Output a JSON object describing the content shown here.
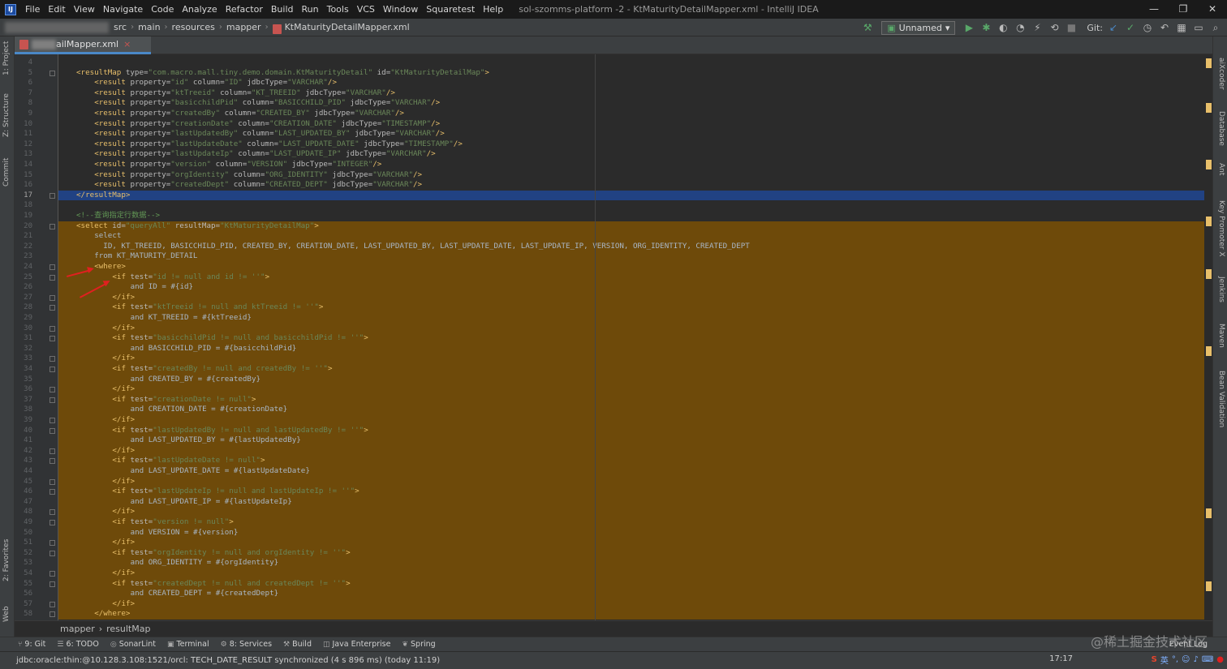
{
  "menu": {
    "items": [
      "File",
      "Edit",
      "View",
      "Navigate",
      "Code",
      "Analyze",
      "Refactor",
      "Build",
      "Run",
      "Tools",
      "VCS",
      "Window",
      "Squaretest",
      "Help"
    ],
    "window_title": "sol-szomms-platform -2 - KtMaturityDetailMapper.xml - IntelliJ IDEA"
  },
  "nav": {
    "crumbs": [
      "src",
      "main",
      "resources",
      "mapper",
      "KtMaturityDetailMapper.xml"
    ],
    "run_config": "Unnamed",
    "git_label": "Git:"
  },
  "tab": {
    "name": "ailMapper.xml",
    "close": "×"
  },
  "left_tools": [
    "1: Project",
    "Z: Structure",
    "Commit",
    "2: Favorites",
    "Web"
  ],
  "right_tools": [
    "aiXcoder",
    "Database",
    "Ant",
    "Key Promoter X",
    "Jenkins",
    "Maven",
    "Bean Validation"
  ],
  "editor": {
    "current_line": 17,
    "lines": [
      {
        "n": 4,
        "parts": []
      },
      {
        "n": 5,
        "parts": [
          [
            "tag",
            "<resultMap "
          ],
          [
            "attr",
            "type="
          ],
          [
            "val",
            "\"com.macro.mall.tiny.demo.domain.KtMaturityDetail\" "
          ],
          [
            "attr",
            "id="
          ],
          [
            "val",
            "\"KtMaturityDetailMap\""
          ],
          [
            "tag",
            ">"
          ]
        ],
        "indent": 0
      },
      {
        "n": 6,
        "parts": [
          [
            "tag",
            "<result "
          ],
          [
            "attr",
            "property="
          ],
          [
            "val",
            "\"id\" "
          ],
          [
            "attr",
            "column="
          ],
          [
            "val",
            "\"ID\" "
          ],
          [
            "attr",
            "jdbcType="
          ],
          [
            "val",
            "\"VARCHAR\""
          ],
          [
            "tag",
            "/>"
          ]
        ],
        "indent": 1
      },
      {
        "n": 7,
        "parts": [
          [
            "tag",
            "<result "
          ],
          [
            "attr",
            "property="
          ],
          [
            "val",
            "\"ktTreeid\" "
          ],
          [
            "attr",
            "column="
          ],
          [
            "val",
            "\"KT_TREEID\" "
          ],
          [
            "attr",
            "jdbcType="
          ],
          [
            "val",
            "\"VARCHAR\""
          ],
          [
            "tag",
            "/>"
          ]
        ],
        "indent": 1
      },
      {
        "n": 8,
        "parts": [
          [
            "tag",
            "<result "
          ],
          [
            "attr",
            "property="
          ],
          [
            "val",
            "\"basicchildPid\" "
          ],
          [
            "attr",
            "column="
          ],
          [
            "val",
            "\"BASICCHILD_PID\" "
          ],
          [
            "attr",
            "jdbcType="
          ],
          [
            "val",
            "\"VARCHAR\""
          ],
          [
            "tag",
            "/>"
          ]
        ],
        "indent": 1
      },
      {
        "n": 9,
        "parts": [
          [
            "tag",
            "<result "
          ],
          [
            "attr",
            "property="
          ],
          [
            "val",
            "\"createdBy\" "
          ],
          [
            "attr",
            "column="
          ],
          [
            "val",
            "\"CREATED_BY\" "
          ],
          [
            "attr",
            "jdbcType="
          ],
          [
            "val",
            "\"VARCHAR\""
          ],
          [
            "tag",
            "/>"
          ]
        ],
        "indent": 1
      },
      {
        "n": 10,
        "parts": [
          [
            "tag",
            "<result "
          ],
          [
            "attr",
            "property="
          ],
          [
            "val",
            "\"creationDate\" "
          ],
          [
            "attr",
            "column="
          ],
          [
            "val",
            "\"CREATION_DATE\" "
          ],
          [
            "attr",
            "jdbcType="
          ],
          [
            "val",
            "\"TIMESTAMP\""
          ],
          [
            "tag",
            "/>"
          ]
        ],
        "indent": 1
      },
      {
        "n": 11,
        "parts": [
          [
            "tag",
            "<result "
          ],
          [
            "attr",
            "property="
          ],
          [
            "val",
            "\"lastUpdatedBy\" "
          ],
          [
            "attr",
            "column="
          ],
          [
            "val",
            "\"LAST_UPDATED_BY\" "
          ],
          [
            "attr",
            "jdbcType="
          ],
          [
            "val",
            "\"VARCHAR\""
          ],
          [
            "tag",
            "/>"
          ]
        ],
        "indent": 1
      },
      {
        "n": 12,
        "parts": [
          [
            "tag",
            "<result "
          ],
          [
            "attr",
            "property="
          ],
          [
            "val",
            "\"lastUpdateDate\" "
          ],
          [
            "attr",
            "column="
          ],
          [
            "val",
            "\"LAST_UPDATE_DATE\" "
          ],
          [
            "attr",
            "jdbcType="
          ],
          [
            "val",
            "\"TIMESTAMP\""
          ],
          [
            "tag",
            "/>"
          ]
        ],
        "indent": 1
      },
      {
        "n": 13,
        "parts": [
          [
            "tag",
            "<result "
          ],
          [
            "attr",
            "property="
          ],
          [
            "val",
            "\"lastUpdateIp\" "
          ],
          [
            "attr",
            "column="
          ],
          [
            "val",
            "\"LAST_UPDATE_IP\" "
          ],
          [
            "attr",
            "jdbcType="
          ],
          [
            "val",
            "\"VARCHAR\""
          ],
          [
            "tag",
            "/>"
          ]
        ],
        "indent": 1
      },
      {
        "n": 14,
        "parts": [
          [
            "tag",
            "<result "
          ],
          [
            "attr",
            "property="
          ],
          [
            "val",
            "\"version\" "
          ],
          [
            "attr",
            "column="
          ],
          [
            "val",
            "\"VERSION\" "
          ],
          [
            "attr",
            "jdbcType="
          ],
          [
            "val",
            "\"INTEGER\""
          ],
          [
            "tag",
            "/>"
          ]
        ],
        "indent": 1
      },
      {
        "n": 15,
        "parts": [
          [
            "tag",
            "<result "
          ],
          [
            "attr",
            "property="
          ],
          [
            "val",
            "\"orgIdentity\" "
          ],
          [
            "attr",
            "column="
          ],
          [
            "val",
            "\"ORG_IDENTITY\" "
          ],
          [
            "attr",
            "jdbcType="
          ],
          [
            "val",
            "\"VARCHAR\""
          ],
          [
            "tag",
            "/>"
          ]
        ],
        "indent": 1
      },
      {
        "n": 16,
        "parts": [
          [
            "tag",
            "<result "
          ],
          [
            "attr",
            "property="
          ],
          [
            "val",
            "\"createdDept\" "
          ],
          [
            "attr",
            "column="
          ],
          [
            "val",
            "\"CREATED_DEPT\" "
          ],
          [
            "attr",
            "jdbcType="
          ],
          [
            "val",
            "\"VARCHAR\""
          ],
          [
            "tag",
            "/>"
          ]
        ],
        "indent": 1
      },
      {
        "n": 17,
        "parts": [
          [
            "tag",
            "</resultMap>"
          ]
        ],
        "indent": 0
      },
      {
        "n": 18,
        "parts": []
      },
      {
        "n": 19,
        "parts": [
          [
            "cmt",
            "<!--查询指定行数据-->"
          ]
        ],
        "indent": 0
      },
      {
        "n": 20,
        "parts": [
          [
            "tag",
            "<select "
          ],
          [
            "attr",
            "id="
          ],
          [
            "val",
            "\"queryAll\" "
          ],
          [
            "attr",
            "resultMap="
          ],
          [
            "val",
            "\"KtMaturityDetailMap\""
          ],
          [
            "tag",
            ">"
          ]
        ],
        "indent": 0
      },
      {
        "n": 21,
        "parts": [
          [
            "plain",
            "select"
          ]
        ],
        "indent": 1
      },
      {
        "n": 22,
        "parts": [
          [
            "plain",
            "ID, KT_TREEID, BASICCHILD_PID, CREATED_BY, CREATION_DATE, LAST_UPDATED_BY, LAST_UPDATE_DATE, LAST_UPDATE_IP, VERSION, ORG_IDENTITY, CREATED_DEPT"
          ]
        ],
        "indent": 1.5
      },
      {
        "n": 23,
        "parts": [
          [
            "plain",
            "from KT_MATURITY_DETAIL"
          ]
        ],
        "indent": 1
      },
      {
        "n": 24,
        "parts": [
          [
            "tag",
            "<where>"
          ]
        ],
        "indent": 1
      },
      {
        "n": 25,
        "parts": [
          [
            "tag",
            "<if "
          ],
          [
            "attr",
            "test="
          ],
          [
            "val",
            "\"id != null and id != ''\""
          ],
          [
            "tag",
            ">"
          ]
        ],
        "indent": 2
      },
      {
        "n": 26,
        "parts": [
          [
            "plain",
            "and ID = #{id}"
          ]
        ],
        "indent": 3
      },
      {
        "n": 27,
        "parts": [
          [
            "tag",
            "</if>"
          ]
        ],
        "indent": 2
      },
      {
        "n": 28,
        "parts": [
          [
            "tag",
            "<if "
          ],
          [
            "attr",
            "test="
          ],
          [
            "val",
            "\"ktTreeid != null and ktTreeid != ''\""
          ],
          [
            "tag",
            ">"
          ]
        ],
        "indent": 2
      },
      {
        "n": 29,
        "parts": [
          [
            "plain",
            "and KT_TREEID = #{ktTreeid}"
          ]
        ],
        "indent": 3
      },
      {
        "n": 30,
        "parts": [
          [
            "tag",
            "</if>"
          ]
        ],
        "indent": 2
      },
      {
        "n": 31,
        "parts": [
          [
            "tag",
            "<if "
          ],
          [
            "attr",
            "test="
          ],
          [
            "val",
            "\"basicchildPid != null and basicchildPid != ''\""
          ],
          [
            "tag",
            ">"
          ]
        ],
        "indent": 2
      },
      {
        "n": 32,
        "parts": [
          [
            "plain",
            "and BASICCHILD_PID = #{basicchildPid}"
          ]
        ],
        "indent": 3
      },
      {
        "n": 33,
        "parts": [
          [
            "tag",
            "</if>"
          ]
        ],
        "indent": 2
      },
      {
        "n": 34,
        "parts": [
          [
            "tag",
            "<if "
          ],
          [
            "attr",
            "test="
          ],
          [
            "val",
            "\"createdBy != null and createdBy != ''\""
          ],
          [
            "tag",
            ">"
          ]
        ],
        "indent": 2
      },
      {
        "n": 35,
        "parts": [
          [
            "plain",
            "and CREATED_BY = #{createdBy}"
          ]
        ],
        "indent": 3
      },
      {
        "n": 36,
        "parts": [
          [
            "tag",
            "</if>"
          ]
        ],
        "indent": 2
      },
      {
        "n": 37,
        "parts": [
          [
            "tag",
            "<if "
          ],
          [
            "attr",
            "test="
          ],
          [
            "val",
            "\"creationDate != null\""
          ],
          [
            "tag",
            ">"
          ]
        ],
        "indent": 2
      },
      {
        "n": 38,
        "parts": [
          [
            "plain",
            "and CREATION_DATE = #{creationDate}"
          ]
        ],
        "indent": 3
      },
      {
        "n": 39,
        "parts": [
          [
            "tag",
            "</if>"
          ]
        ],
        "indent": 2
      },
      {
        "n": 40,
        "parts": [
          [
            "tag",
            "<if "
          ],
          [
            "attr",
            "test="
          ],
          [
            "val",
            "\"lastUpdatedBy != null and lastUpdatedBy != ''\""
          ],
          [
            "tag",
            ">"
          ]
        ],
        "indent": 2
      },
      {
        "n": 41,
        "parts": [
          [
            "plain",
            "and LAST_UPDATED_BY = #{lastUpdatedBy}"
          ]
        ],
        "indent": 3
      },
      {
        "n": 42,
        "parts": [
          [
            "tag",
            "</if>"
          ]
        ],
        "indent": 2
      },
      {
        "n": 43,
        "parts": [
          [
            "tag",
            "<if "
          ],
          [
            "attr",
            "test="
          ],
          [
            "val",
            "\"lastUpdateDate != null\""
          ],
          [
            "tag",
            ">"
          ]
        ],
        "indent": 2
      },
      {
        "n": 44,
        "parts": [
          [
            "plain",
            "and LAST_UPDATE_DATE = #{lastUpdateDate}"
          ]
        ],
        "indent": 3
      },
      {
        "n": 45,
        "parts": [
          [
            "tag",
            "</if>"
          ]
        ],
        "indent": 2
      },
      {
        "n": 46,
        "parts": [
          [
            "tag",
            "<if "
          ],
          [
            "attr",
            "test="
          ],
          [
            "val",
            "\"lastUpdateIp != null and lastUpdateIp != ''\""
          ],
          [
            "tag",
            ">"
          ]
        ],
        "indent": 2
      },
      {
        "n": 47,
        "parts": [
          [
            "plain",
            "and LAST_UPDATE_IP = #{lastUpdateIp}"
          ]
        ],
        "indent": 3
      },
      {
        "n": 48,
        "parts": [
          [
            "tag",
            "</if>"
          ]
        ],
        "indent": 2
      },
      {
        "n": 49,
        "parts": [
          [
            "tag",
            "<if "
          ],
          [
            "attr",
            "test="
          ],
          [
            "val",
            "\"version != null\""
          ],
          [
            "tag",
            ">"
          ]
        ],
        "indent": 2
      },
      {
        "n": 50,
        "parts": [
          [
            "plain",
            "and VERSION = #{version}"
          ]
        ],
        "indent": 3
      },
      {
        "n": 51,
        "parts": [
          [
            "tag",
            "</if>"
          ]
        ],
        "indent": 2
      },
      {
        "n": 52,
        "parts": [
          [
            "tag",
            "<if "
          ],
          [
            "attr",
            "test="
          ],
          [
            "val",
            "\"orgIdentity != null and orgIdentity != ''\""
          ],
          [
            "tag",
            ">"
          ]
        ],
        "indent": 2
      },
      {
        "n": 53,
        "parts": [
          [
            "plain",
            "and ORG_IDENTITY = #{orgIdentity}"
          ]
        ],
        "indent": 3
      },
      {
        "n": 54,
        "parts": [
          [
            "tag",
            "</if>"
          ]
        ],
        "indent": 2
      },
      {
        "n": 55,
        "parts": [
          [
            "tag",
            "<if "
          ],
          [
            "attr",
            "test="
          ],
          [
            "val",
            "\"createdDept != null and createdDept != ''\""
          ],
          [
            "tag",
            ">"
          ]
        ],
        "indent": 2
      },
      {
        "n": 56,
        "parts": [
          [
            "plain",
            "and CREATED_DEPT = #{createdDept}"
          ]
        ],
        "indent": 3
      },
      {
        "n": 57,
        "parts": [
          [
            "tag",
            "</if>"
          ]
        ],
        "indent": 2
      },
      {
        "n": 58,
        "parts": [
          [
            "tag",
            "</where>"
          ]
        ],
        "indent": 1
      }
    ]
  },
  "breadcrumb": {
    "items": [
      "mapper",
      "resultMap"
    ]
  },
  "tool_windows": [
    {
      "icon": "git-icon",
      "label": "9: Git"
    },
    {
      "icon": "todo-icon",
      "label": "6: TODO"
    },
    {
      "icon": "sonarlint-icon",
      "label": "SonarLint"
    },
    {
      "icon": "terminal-icon",
      "label": "Terminal"
    },
    {
      "icon": "services-icon",
      "label": "8: Services"
    },
    {
      "icon": "build-icon",
      "label": "Build"
    },
    {
      "icon": "java-enterprise-icon",
      "label": "Java Enterprise"
    },
    {
      "icon": "spring-icon",
      "label": "Spring"
    }
  ],
  "event_log": "Event Log",
  "status": {
    "message": "jdbc:oracle:thin:@10.128.3.108:1521/orcl: TECH_DATE_RESULT synchronized (4 s 896 ms) (today 11:19)",
    "clock": "17:17",
    "watermark": "@稀土掘金技术社区",
    "ime": "英"
  },
  "colors": {
    "selection": "#6e4a0a",
    "current_line": "#214283",
    "tag": "#e8bf6a",
    "attr_value": "#6a8759",
    "comment": "#629755",
    "accent_arrow": "#e02020"
  }
}
